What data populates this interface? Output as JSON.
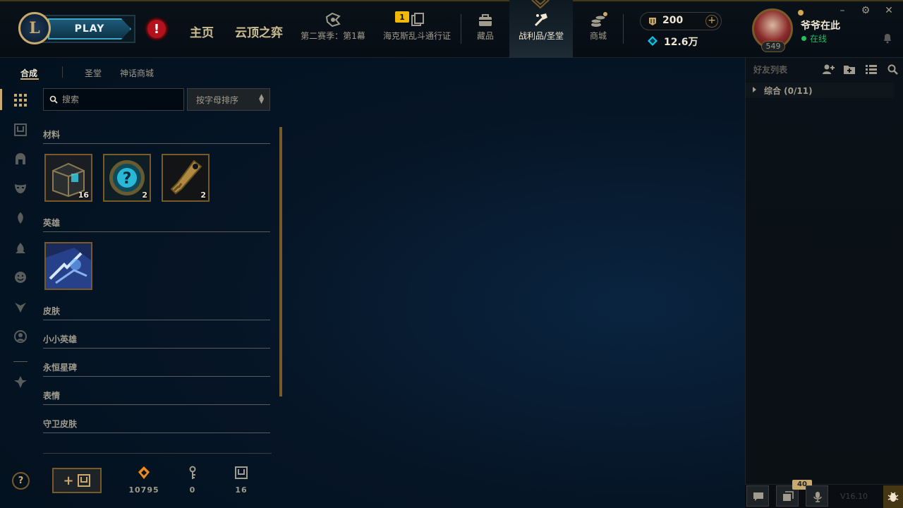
{
  "topbar": {
    "logo_letter": "L",
    "play_label": "PLAY",
    "alert_glyph": "!",
    "nav_home": "主页",
    "nav_tft": "云顶之弈",
    "nav_season": "第二赛季：第1幕",
    "nav_pass": "海克斯乱斗通行证",
    "pass_badge": "1",
    "nav_collection": "藏品",
    "nav_loot": "战利品/圣堂",
    "nav_store": "商城",
    "rp_amount": "200",
    "be_amount": "12.6万",
    "summoner_name": "爷爷在此",
    "status": "在线",
    "level": "549",
    "minimize": "–",
    "settings": "⚙",
    "close": "✕"
  },
  "subnav": {
    "tab_craft": "合成",
    "tab_sanctum": "圣堂",
    "tab_mythic": "神话商城"
  },
  "search": {
    "placeholder": "搜索",
    "sort_label": "按字母排序"
  },
  "categories": {
    "materials": "材料",
    "champions": "英雄",
    "skins": "皮肤",
    "little_legends": "小小英雄",
    "eternals": "永恒星碑",
    "emotes": "表情",
    "ward_skins": "守卫皮肤"
  },
  "materials": [
    {
      "icon": "chest-icon",
      "count": "16"
    },
    {
      "icon": "mystery-orb-icon",
      "count": "2"
    },
    {
      "icon": "key-fragment-icon",
      "count": "2"
    }
  ],
  "champions": [
    {
      "icon": "champion-shard-icon"
    }
  ],
  "bottom": {
    "craft_plus": "+",
    "orange_essence": "10795",
    "keys": "0",
    "chests": "16",
    "help": "?"
  },
  "social": {
    "title": "好友列表",
    "group": "综合 (0/11)",
    "chat_count": "40",
    "version": "V16.10"
  },
  "colors": {
    "gold": "#c8aa6e",
    "dark_gold": "#785a28",
    "text": "#a09b8c",
    "online": "#1fbf62",
    "background": "#010a13"
  }
}
